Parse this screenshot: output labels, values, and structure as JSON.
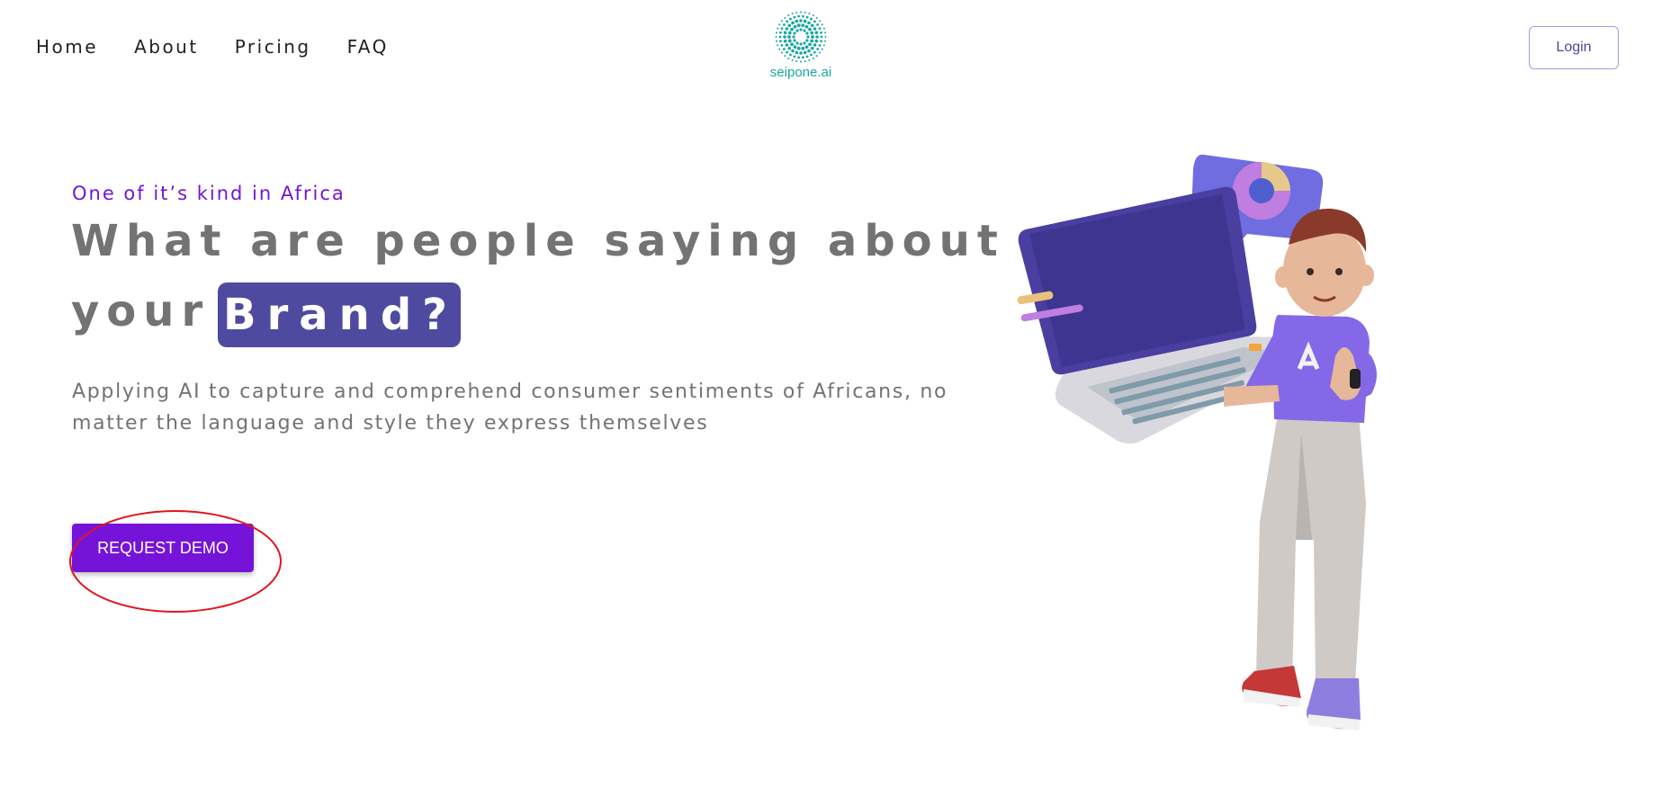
{
  "nav": {
    "links": [
      "Home",
      "About",
      "Pricing",
      "FAQ"
    ],
    "login_label": "Login"
  },
  "logo": {
    "text": "seipone.ai",
    "color": "#1aa7a0"
  },
  "hero": {
    "tagline": "One of it’s kind in Africa",
    "headline_line1": "What are people saying about",
    "headline_line2_prefix": "your",
    "headline_highlight": "Brand?",
    "subtitle": "Applying AI to capture and comprehend consumer sentiments of Africans, no matter the language and style they express themselves",
    "cta_label": "REQUEST DEMO"
  },
  "colors": {
    "accent": "#7514d8",
    "brand_pill": "#4d4aa0",
    "text_gray": "#737373",
    "annotation_ring": "#e0161e"
  },
  "icons": {
    "logo_mark": "dotted-circle-logo-icon",
    "illustration": "person-with-laptop-illustration"
  }
}
